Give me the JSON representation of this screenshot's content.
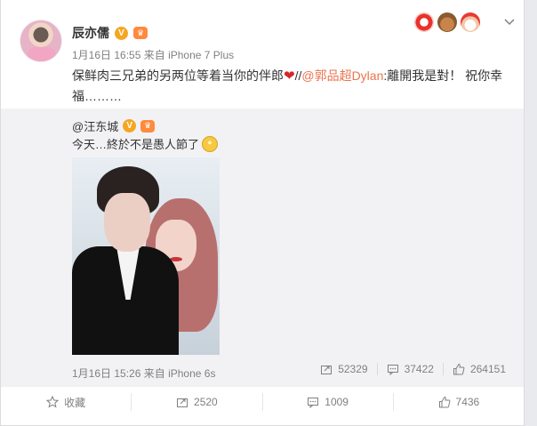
{
  "post": {
    "author": "辰亦儒",
    "verified_badge": "V",
    "time": "1月16日 16:55",
    "source": "来自 iPhone 7 Plus",
    "text_before": "保鲜肉三兄弟的另两位等着当你的伴郎",
    "text_slashes": "//",
    "mention": "@郭品超Dylan",
    "text_after": ":離開我是對！ 祝你幸福………"
  },
  "repost": {
    "author": "@汪东城",
    "verified_badge": "V",
    "text": "今天…終於不是愚人節了",
    "time": "1月16日 15:26",
    "source": "来自 iPhone 6s",
    "stats": {
      "repost_count": "52329",
      "comment_count": "37422",
      "like_count": "264151"
    }
  },
  "actions": {
    "favorite_label": "收藏",
    "repost_count": "2520",
    "comment_count": "1009",
    "like_count": "7436"
  },
  "colors": {
    "mention": "#eb7350",
    "badge": "#f5a623",
    "heart": "#d8242b"
  },
  "icons": [
    "avatar",
    "verified-icon",
    "member-crown-icon",
    "heart-icon",
    "festive-icons",
    "chevron-down-icon",
    "repost-icon",
    "comment-icon",
    "like-icon",
    "star-icon"
  ]
}
